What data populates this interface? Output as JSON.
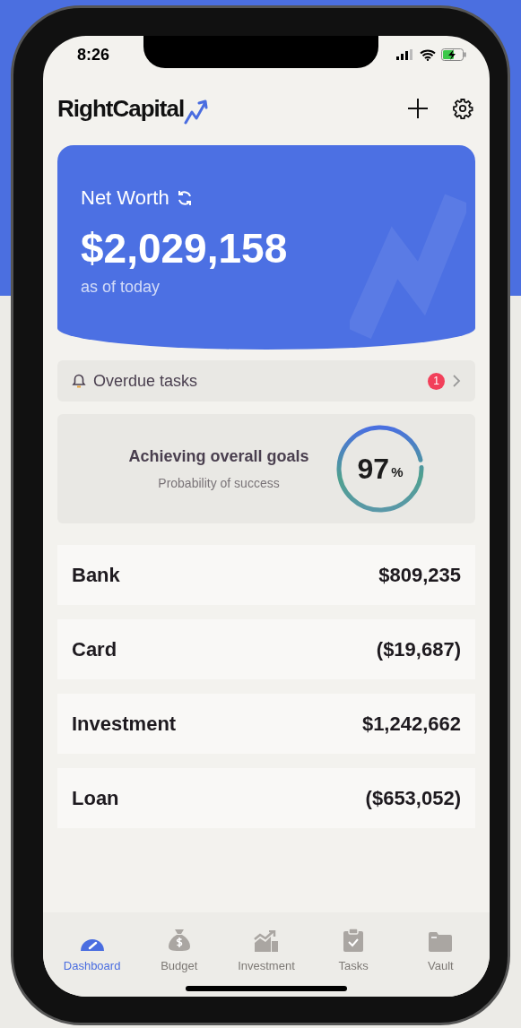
{
  "status_bar": {
    "time": "8:26"
  },
  "header": {
    "logo": "RightCapital"
  },
  "net_worth": {
    "title": "Net Worth",
    "amount": "$2,029,158",
    "subtitle": "as of today"
  },
  "overdue": {
    "label": "Overdue tasks",
    "count": "1"
  },
  "goals": {
    "title": "Achieving overall goals",
    "subtitle": "Probability of success",
    "value": "97",
    "unit": "%",
    "level": 0.97
  },
  "accounts": [
    {
      "name": "Bank",
      "amount": "$809,235"
    },
    {
      "name": "Card",
      "amount": "($19,687)"
    },
    {
      "name": "Investment",
      "amount": "$1,242,662"
    },
    {
      "name": "Loan",
      "amount": "($653,052)"
    }
  ],
  "tabs": [
    {
      "label": "Dashboard",
      "selected": true
    },
    {
      "label": "Budget",
      "selected": false
    },
    {
      "label": "Investment",
      "selected": false
    },
    {
      "label": "Tasks",
      "selected": false
    },
    {
      "label": "Vault",
      "selected": false
    }
  ]
}
